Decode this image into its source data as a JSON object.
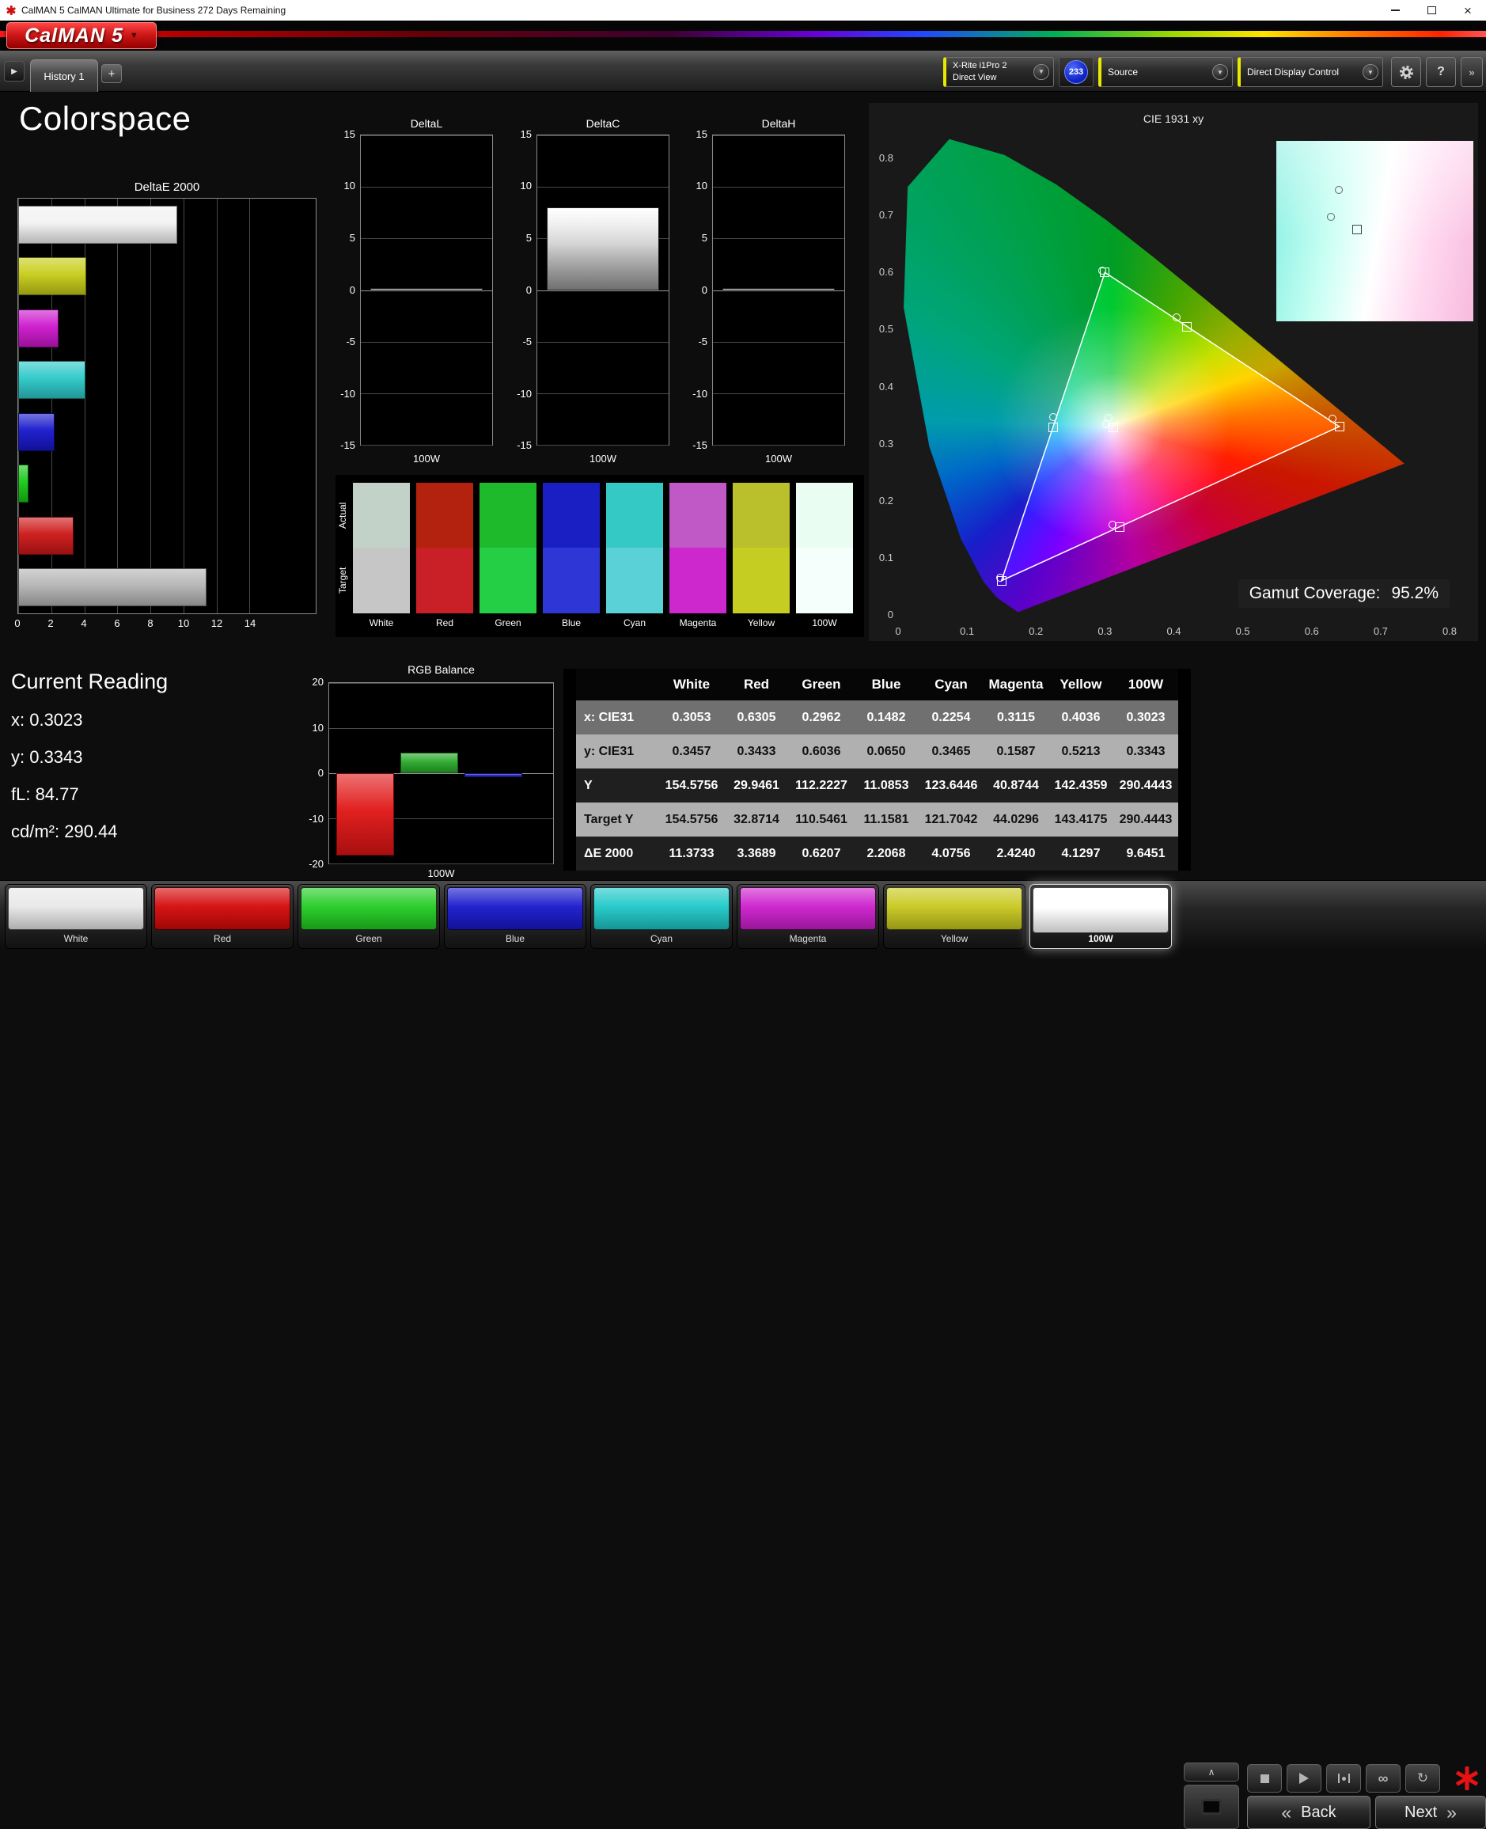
{
  "window": {
    "title": "CalMAN 5 CalMAN Ultimate for Business 272 Days Remaining"
  },
  "brand": {
    "logo_text": "CalMAN 5"
  },
  "theme": {
    "accent_yellow": "#e8e800",
    "brand_red": "#cc1111",
    "badge_blue": "#1a2fd0"
  },
  "toolbar": {
    "tab_label": "History 1",
    "add_tab_label": "+",
    "meter_line1": "X-Rite i1Pro 2",
    "meter_line2": "Direct View",
    "meter_badge": "233",
    "source_label": "Source",
    "display_control_label": "Direct Display Control"
  },
  "page": {
    "title": "Colorspace"
  },
  "current_reading": {
    "title": "Current Reading",
    "x": "x: 0.3023",
    "y": "y: 0.3343",
    "fl": "fL: 84.77",
    "cd": "cd/m²: 290.44"
  },
  "cie": {
    "gamut_coverage_label": "Gamut Coverage:",
    "gamut_coverage_value": "95.2%"
  },
  "swatches": {
    "row_labels": [
      "Actual",
      "Target"
    ],
    "columns": [
      {
        "name": "White",
        "actual": "#c2d2c8",
        "target": "#c6c6c6"
      },
      {
        "name": "Red",
        "actual": "#b2220f",
        "target": "#c92028"
      },
      {
        "name": "Green",
        "actual": "#1fb92c",
        "target": "#24cf46"
      },
      {
        "name": "Blue",
        "actual": "#1a1fc4",
        "target": "#2f36d6"
      },
      {
        "name": "Cyan",
        "actual": "#35c9c6",
        "target": "#5ad1d6"
      },
      {
        "name": "Magenta",
        "actual": "#c058c6",
        "target": "#cd28ce"
      },
      {
        "name": "Yellow",
        "actual": "#babf2c",
        "target": "#c6cd22"
      },
      {
        "name": "100W",
        "actual": "#eafdf3",
        "target": "#f5fffb"
      }
    ]
  },
  "bottom_bar": {
    "color_buttons": [
      {
        "label": "White",
        "color": "#e8e8e8"
      },
      {
        "label": "Red",
        "color": "#d40808"
      },
      {
        "label": "Green",
        "color": "#22cc22"
      },
      {
        "label": "Blue",
        "color": "#1818cc"
      },
      {
        "label": "Cyan",
        "color": "#1ec8c8"
      },
      {
        "label": "Magenta",
        "color": "#cc1ecc"
      },
      {
        "label": "Yellow",
        "color": "#c8c81e"
      },
      {
        "label": "100W",
        "color": "#ffffff",
        "selected": true
      }
    ],
    "back_label": "Back",
    "next_label": "Next"
  },
  "chart_data": [
    {
      "id": "deltae2000",
      "type": "bar",
      "orientation": "horizontal",
      "title": "DeltaE 2000",
      "categories": [
        "100W",
        "Yellow",
        "Magenta",
        "Cyan",
        "Blue",
        "Green",
        "Red",
        "White"
      ],
      "values": [
        9.6451,
        4.1297,
        2.424,
        4.0756,
        2.2068,
        0.6207,
        3.3689,
        11.3733
      ],
      "colors": [
        "#f2f2f2",
        "#c6cc17",
        "#cc16cc",
        "#2cc8c8",
        "#1616cc",
        "#16c816",
        "#cc1616",
        "#b4b4b4"
      ],
      "xlim": [
        0,
        14
      ],
      "xticks": [
        0,
        2,
        4,
        6,
        8,
        10,
        12,
        14
      ]
    },
    {
      "id": "deltaL",
      "type": "bar",
      "title": "DeltaL",
      "categories": [
        "100W"
      ],
      "values": [
        0
      ],
      "ylim": [
        -15,
        15
      ],
      "yticks": [
        15,
        10,
        5,
        0,
        -5,
        -10,
        -15
      ]
    },
    {
      "id": "deltaC",
      "type": "bar",
      "title": "DeltaC",
      "categories": [
        "100W"
      ],
      "values": [
        8.0
      ],
      "ylim": [
        -15,
        15
      ],
      "yticks": [
        15,
        10,
        5,
        0,
        -5,
        -10,
        -15
      ]
    },
    {
      "id": "deltaH",
      "type": "bar",
      "title": "DeltaH",
      "categories": [
        "100W"
      ],
      "values": [
        0
      ],
      "ylim": [
        -15,
        15
      ],
      "yticks": [
        15,
        10,
        5,
        0,
        -5,
        -10,
        -15
      ]
    },
    {
      "id": "rgb_balance",
      "type": "bar",
      "title": "RGB Balance",
      "categories": [
        "Red",
        "Green",
        "Blue"
      ],
      "values": [
        -18.2,
        4.5,
        -0.9
      ],
      "colors": [
        "#e01414",
        "#28a828",
        "#2828cc"
      ],
      "xlabel": "100W",
      "ylim": [
        -20,
        20
      ],
      "yticks": [
        20,
        10,
        0,
        -10,
        -20
      ]
    },
    {
      "id": "cie1931",
      "type": "scatter",
      "title": "CIE 1931 xy",
      "xlim": [
        0,
        0.8
      ],
      "ylim": [
        0,
        0.8
      ],
      "xticks": [
        0,
        0.1,
        0.2,
        0.3,
        0.4,
        0.5,
        0.6,
        0.7,
        0.8
      ],
      "yticks": [
        0,
        0.1,
        0.2,
        0.3,
        0.4,
        0.5,
        0.6,
        0.7,
        0.8
      ],
      "gamut_coverage_pct": 95.2,
      "measured": [
        {
          "name": "White",
          "x": 0.3053,
          "y": 0.3457
        },
        {
          "name": "Red",
          "x": 0.6305,
          "y": 0.3433
        },
        {
          "name": "Green",
          "x": 0.2962,
          "y": 0.6036
        },
        {
          "name": "Blue",
          "x": 0.1482,
          "y": 0.065
        },
        {
          "name": "Cyan",
          "x": 0.2254,
          "y": 0.3465
        },
        {
          "name": "Magenta",
          "x": 0.3115,
          "y": 0.1587
        },
        {
          "name": "Yellow",
          "x": 0.4036,
          "y": 0.5213
        },
        {
          "name": "100W",
          "x": 0.3023,
          "y": 0.3343
        }
      ],
      "targets": [
        {
          "name": "White",
          "x": 0.3127,
          "y": 0.329
        },
        {
          "name": "Red",
          "x": 0.64,
          "y": 0.33
        },
        {
          "name": "Green",
          "x": 0.3,
          "y": 0.6
        },
        {
          "name": "Blue",
          "x": 0.15,
          "y": 0.06
        },
        {
          "name": "Cyan",
          "x": 0.2246,
          "y": 0.3287
        },
        {
          "name": "Magenta",
          "x": 0.3209,
          "y": 0.1542
        },
        {
          "name": "Yellow",
          "x": 0.4193,
          "y": 0.5053
        }
      ],
      "gamut_triangle": [
        [
          0.64,
          0.33
        ],
        [
          0.3,
          0.6
        ],
        [
          0.15,
          0.06
        ]
      ],
      "inset": {
        "xrange": [
          0.28,
          0.36
        ],
        "yrange": [
          0.291,
          0.366
        ],
        "show": [
          "White",
          "100W"
        ]
      }
    },
    {
      "id": "measurement_table",
      "type": "table",
      "columns": [
        "White",
        "Red",
        "Green",
        "Blue",
        "Cyan",
        "Magenta",
        "Yellow",
        "100W"
      ],
      "rows": [
        {
          "label": "x: CIE31",
          "values": [
            "0.3053",
            "0.6305",
            "0.2962",
            "0.1482",
            "0.2254",
            "0.3115",
            "0.4036",
            "0.3023"
          ]
        },
        {
          "label": "y: CIE31",
          "values": [
            "0.3457",
            "0.3433",
            "0.6036",
            "0.0650",
            "0.3465",
            "0.1587",
            "0.5213",
            "0.3343"
          ]
        },
        {
          "label": "Y",
          "values": [
            "154.5756",
            "29.9461",
            "112.2227",
            "11.0853",
            "123.6446",
            "40.8744",
            "142.4359",
            "290.4443"
          ]
        },
        {
          "label": "Target Y",
          "values": [
            "154.5756",
            "32.8714",
            "110.5461",
            "11.1581",
            "121.7042",
            "44.0296",
            "143.4175",
            "290.4443"
          ]
        },
        {
          "label": "ΔE 2000",
          "values": [
            "11.3733",
            "3.3689",
            "0.6207",
            "2.2068",
            "4.0756",
            "2.4240",
            "4.1297",
            "9.6451"
          ]
        }
      ]
    }
  ]
}
